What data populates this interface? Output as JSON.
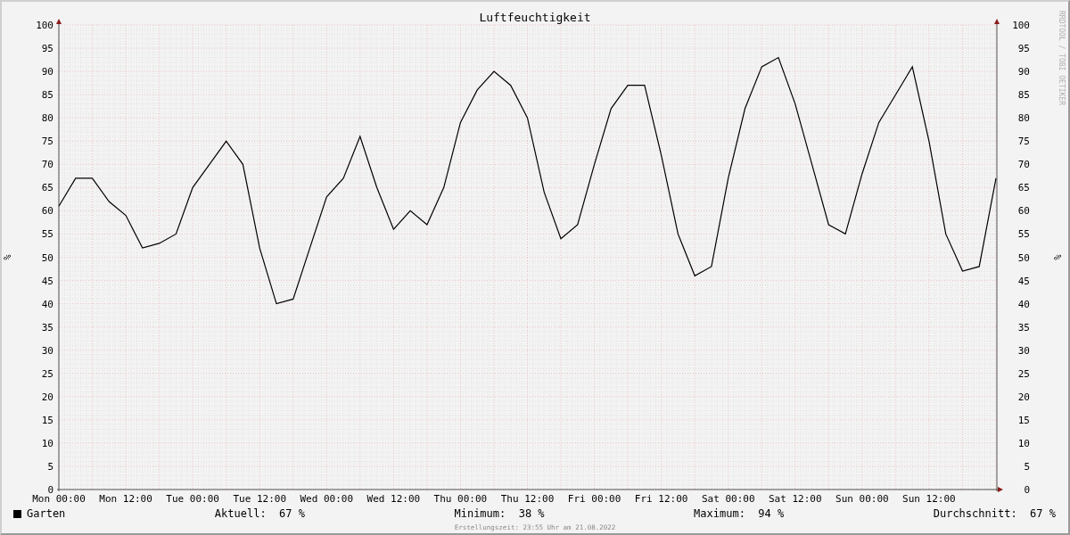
{
  "chart_data": {
    "type": "line",
    "title": "Luftfeuchtigkeit",
    "ylabel": "%",
    "categories": [
      "Mon 00:00",
      null,
      null,
      null,
      "Mon 12:00",
      null,
      null,
      null,
      "Tue 00:00",
      null,
      null,
      null,
      "Tue 12:00",
      null,
      null,
      null,
      "Wed 00:00",
      null,
      null,
      null,
      "Wed 12:00",
      null,
      null,
      null,
      "Thu 00:00",
      null,
      null,
      null,
      "Thu 12:00",
      null,
      null,
      null,
      "Fri 00:00",
      null,
      null,
      null,
      "Fri 12:00",
      null,
      null,
      null,
      "Sat 00:00",
      null,
      null,
      null,
      "Sat 12:00",
      null,
      null,
      null,
      "Sun 00:00",
      null,
      null,
      null,
      "Sun 12:00",
      null,
      null,
      null,
      null
    ],
    "series": [
      {
        "name": "Garten",
        "color": "#000000",
        "values": [
          61,
          67,
          67,
          62,
          59,
          52,
          53,
          55,
          65,
          70,
          75,
          70,
          52,
          40,
          41,
          52,
          63,
          67,
          76,
          65,
          56,
          60,
          57,
          65,
          79,
          86,
          90,
          87,
          80,
          64,
          54,
          57,
          70,
          82,
          87,
          87,
          72,
          55,
          46,
          48,
          67,
          82,
          91,
          93,
          83,
          70,
          57,
          55,
          68,
          79,
          85,
          91,
          75,
          55,
          47,
          48,
          67
        ]
      }
    ],
    "ylim": [
      0,
      100
    ],
    "grid": true,
    "yticks": [
      0,
      5,
      10,
      15,
      20,
      25,
      30,
      35,
      40,
      45,
      50,
      55,
      60,
      65,
      70,
      75,
      80,
      85,
      90,
      95,
      100
    ]
  },
  "right_axis": {
    "label": "%",
    "ticks": [
      "100",
      "95",
      "90",
      "85",
      "80",
      "75",
      "70",
      "65",
      "60",
      "55",
      "50",
      "45",
      "40",
      "35",
      "30",
      "25",
      "20",
      "15",
      "10",
      "5",
      "0"
    ]
  },
  "tool_credit": "RRDTOOL / TOBI OETIKER",
  "stats": [
    {
      "label": "Aktuell:",
      "value": "67 %"
    },
    {
      "label": "Minimum:",
      "value": "38 %"
    },
    {
      "label": "Maximum:",
      "value": "94 %"
    },
    {
      "label": "Durchschnitt:",
      "value": "67 %"
    }
  ],
  "footer": "Erstellungszeit: 23:55 Uhr am 21.08.2022"
}
